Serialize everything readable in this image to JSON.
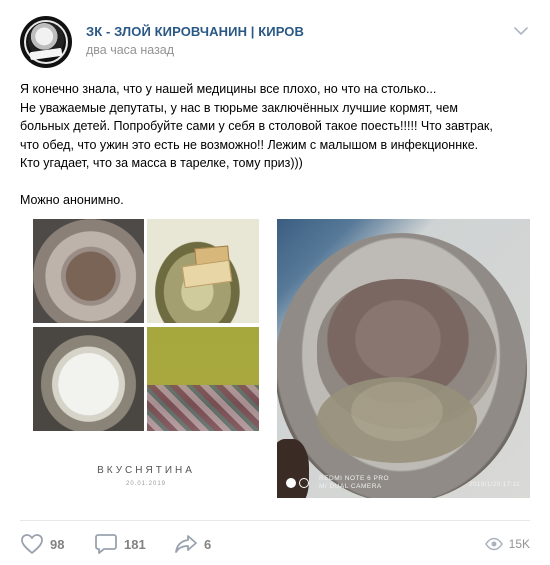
{
  "header": {
    "group_name": "ЗК - ЗЛОЙ КИРОВЧАНИН | КИРОВ",
    "time": "два часа назад"
  },
  "post": {
    "lines": [
      "Я конечно знала, что у нашей медицины все плохо, но что на столько...",
      "Не уважаемые депутаты, у нас в тюрьме заключённых лучшие кормят, чем",
      "больных детей. Попробуйте сами у себя в столовой такое поесть!!!!! Что завтрак,",
      "что обед, что ужин это есть не возможно!! Лежим с малышом в инфекционнке.",
      "Кто угадает, что за масса в тарелке, тому приз)))"
    ],
    "footer_line": "Можно анонимно."
  },
  "collage": {
    "caption": "ВКУСНЯТИНА",
    "date": "20.01.2019"
  },
  "photo": {
    "watermark_line1": "REDMI NOTE 6 PRO",
    "watermark_line2": "MI DUAL CAMERA",
    "timestamp": "2019/1/20 17:11"
  },
  "actions": {
    "likes": "98",
    "comments": "181",
    "shares": "6",
    "views": "15K"
  },
  "colors": {
    "link": "#2a5885",
    "muted": "#939393",
    "icon": "#99a2ad"
  }
}
